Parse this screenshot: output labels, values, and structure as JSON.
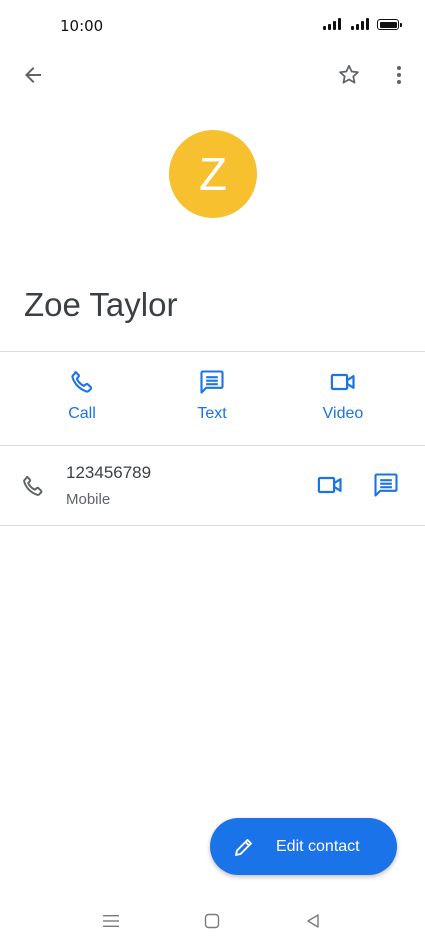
{
  "status_bar": {
    "time": "10:00",
    "icons": [
      "signal-icon",
      "signal-icon",
      "battery-icon"
    ]
  },
  "toolbar": {
    "back_icon": "arrow-left-icon",
    "favorite_icon": "star-outline-icon",
    "more_icon": "more-vert-icon"
  },
  "contact": {
    "avatar_letter": "Z",
    "avatar_color": "#f6c02f",
    "name": "Zoe Taylor"
  },
  "actions": [
    {
      "label": "Call",
      "icon": "phone-icon"
    },
    {
      "label": "Text",
      "icon": "message-icon"
    },
    {
      "label": "Video",
      "icon": "video-icon"
    }
  ],
  "phone_entry": {
    "number": "123456789",
    "type": "Mobile",
    "icon": "phone-icon",
    "video_icon": "video-icon",
    "message_icon": "message-icon"
  },
  "fab": {
    "label": "Edit contact",
    "icon": "pencil-icon",
    "color": "#1a73e8"
  },
  "nav_bar": {
    "icons": [
      "menu-icon",
      "home-icon",
      "back-icon"
    ]
  },
  "colors": {
    "accent": "#1a73e8",
    "divider": "#dadce0"
  }
}
